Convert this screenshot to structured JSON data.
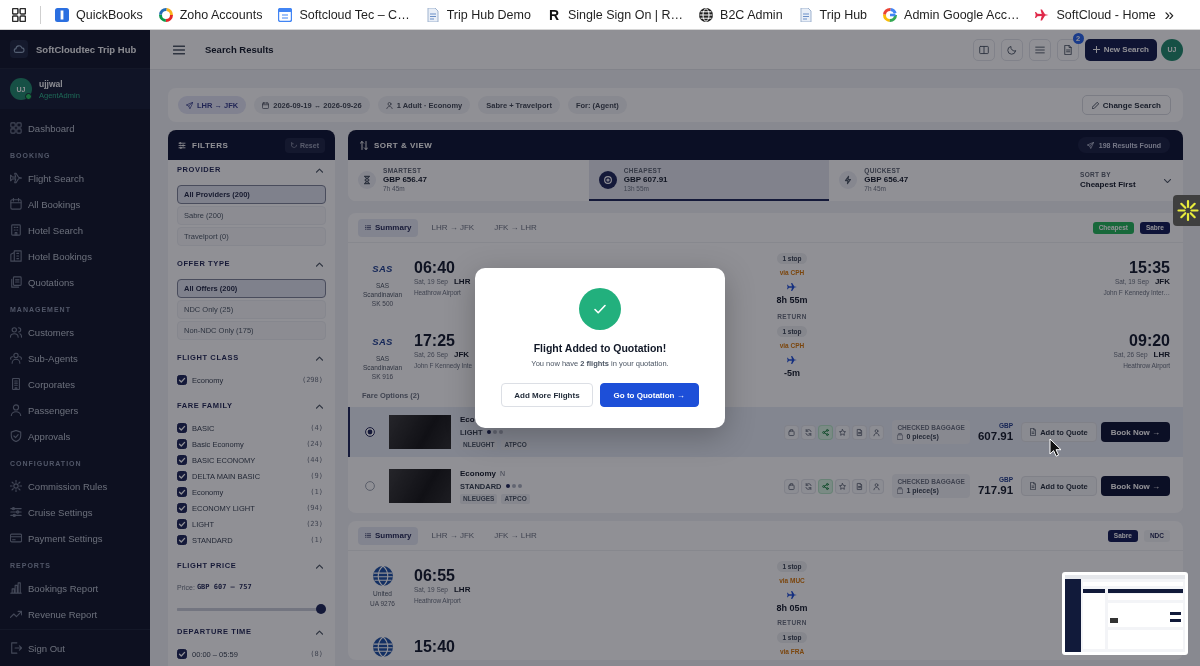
{
  "bookmarks": {
    "items": [
      {
        "label": "QuickBooks"
      },
      {
        "label": "Zoho Accounts"
      },
      {
        "label": "Softcloud Tec – C…"
      },
      {
        "label": "Trip Hub Demo"
      },
      {
        "label": "Single Sign On | R…",
        "icon_text": "R"
      },
      {
        "label": "B2C Admin"
      },
      {
        "label": "Trip Hub"
      },
      {
        "label": "Admin Google Acc…"
      },
      {
        "label": "SoftCloud - Home"
      }
    ],
    "more": "»"
  },
  "sidebar": {
    "brand": "SoftCloudtec Trip Hub",
    "user": {
      "initials": "UJ",
      "name": "ujjwal",
      "role": "AgentAdmin",
      "online": true
    },
    "nav": [
      {
        "items": [
          "Dashboard"
        ]
      },
      {
        "title": "BOOKING",
        "items": [
          "Flight Search",
          "All Bookings",
          "Hotel Search",
          "Hotel Bookings",
          "Quotations"
        ]
      },
      {
        "title": "MANAGEMENT",
        "items": [
          "Customers",
          "Sub-Agents",
          "Corporates",
          "Passengers",
          "Approvals"
        ]
      },
      {
        "title": "CONFIGURATION",
        "items": [
          "Commission Rules",
          "Cruise Settings",
          "Payment Settings"
        ]
      },
      {
        "title": "REPORTS",
        "items": [
          "Bookings Report",
          "Revenue Report"
        ]
      }
    ],
    "sign_out": "Sign Out"
  },
  "topbar": {
    "title": "Search Results",
    "notification_count": "2",
    "new_search": "New Search",
    "avatar": "UJ"
  },
  "search_summary": {
    "chips": [
      {
        "label": "LHR → JFK",
        "kind": "route"
      },
      {
        "label": "2026-09-19 ↔ 2026-09-26",
        "kind": "dates"
      },
      {
        "label": "1 Adult · Economy",
        "kind": "travellers"
      },
      {
        "label": "Sabre + Travelport",
        "kind": "plain"
      },
      {
        "label": "For: (Agent)",
        "kind": "plain"
      }
    ],
    "change_search": "Change Search"
  },
  "filters": {
    "title": "FILTERS",
    "reset": "Reset",
    "sections": [
      {
        "title": "PROVIDER",
        "kind": "options",
        "expanded": true,
        "options": [
          {
            "label": "All Providers (200)",
            "selected": true
          },
          {
            "label": "Sabre (200)",
            "selected": false
          },
          {
            "label": "Travelport (0)",
            "selected": false
          }
        ]
      },
      {
        "title": "OFFER TYPE",
        "kind": "options",
        "expanded": true,
        "options": [
          {
            "label": "All Offers (200)",
            "selected": true
          },
          {
            "label": "NDC Only (25)",
            "selected": false
          },
          {
            "label": "Non-NDC Only (175)",
            "selected": false
          }
        ]
      },
      {
        "title": "FLIGHT CLASS",
        "kind": "checks",
        "expanded": true,
        "items": [
          {
            "label": "Economy",
            "count": "(298)",
            "checked": true
          }
        ]
      },
      {
        "title": "FARE FAMILY",
        "kind": "checks",
        "expanded": true,
        "items": [
          {
            "label": "BASIC",
            "count": "(4)",
            "checked": true
          },
          {
            "label": "Basic Economy",
            "count": "(24)",
            "checked": true
          },
          {
            "label": "BASIC ECONOMY",
            "count": "(44)",
            "checked": true
          },
          {
            "label": "DELTA MAIN BASIC",
            "count": "(9)",
            "checked": true
          },
          {
            "label": "Economy",
            "count": "(1)",
            "checked": true
          },
          {
            "label": "ECONOMY LIGHT",
            "count": "(94)",
            "checked": true
          },
          {
            "label": "LIGHT",
            "count": "(23)",
            "checked": true
          },
          {
            "label": "STANDARD",
            "count": "(1)",
            "checked": true
          }
        ]
      },
      {
        "title": "FLIGHT PRICE",
        "kind": "range",
        "expanded": true,
        "label": "Price:",
        "value": "GBP 607 — 757",
        "level": 1
      },
      {
        "title": "DEPARTURE TIME",
        "kind": "checks",
        "expanded": true,
        "items": [
          {
            "label": "00:00 – 05:59",
            "count": "(8)",
            "checked": true
          }
        ]
      }
    ]
  },
  "sort": {
    "title": "SORT & VIEW",
    "results_found": "198 Results Found",
    "options": [
      {
        "label": "SMARTEST",
        "price": "GBP 656.47",
        "duration": "7h 45m",
        "selected": false
      },
      {
        "label": "CHEAPEST",
        "price": "GBP 607.91",
        "duration": "13h 55m",
        "selected": true
      },
      {
        "label": "QUICKEST",
        "price": "GBP 656.47",
        "duration": "7h 45m",
        "selected": false
      }
    ],
    "sort_by_label": "SORT BY",
    "sort_by": "Cheapest First"
  },
  "results": [
    {
      "tabs": [
        {
          "label": "Summary",
          "selected": true
        },
        {
          "label": "LHR → JFK",
          "selected": false
        },
        {
          "label": "JFK → LHR",
          "selected": false
        }
      ],
      "badges": [
        {
          "label": "Cheapest",
          "kind": "solid",
          "color": "#17693a"
        },
        {
          "label": "Sabre",
          "kind": "solid",
          "color": "#0e1438"
        }
      ],
      "legs": [
        {
          "logo": {
            "kind": "text",
            "text": "SAS"
          },
          "airline": "SAS Scandinavian",
          "flight": "SK 500",
          "depart": {
            "time": "06:40",
            "date": "Sat, 19 Sep",
            "code": "LHR",
            "airport": "Heathrow Airport"
          },
          "stops": "1 stop",
          "via": "via CPH",
          "duration": "8h 55m",
          "arrive": {
            "time": "15:35",
            "date": "Sat, 19 Sep",
            "code": "JFK",
            "airport": "John F Kennedy Inter…"
          }
        },
        {
          "logo": {
            "kind": "text",
            "text": "SAS"
          },
          "airline": "SAS Scandinavian",
          "flight": "SK 916",
          "depart": {
            "time": "17:25",
            "date": "Sat, 26 Sep",
            "code": "JFK",
            "airport": "John F Kennedy Inte"
          },
          "stops": "1 stop",
          "via": "via CPH",
          "duration": "-5m",
          "arrive": {
            "time": "09:20",
            "date": "Sat, 26 Sep",
            "code": "LHR",
            "airport": "Heathrow Airport"
          }
        }
      ],
      "return_label": "RETURN",
      "fares_title": "Fare Options (2)",
      "fares": [
        {
          "selected": true,
          "name": "Eco",
          "brand": "LIGHT",
          "stars": 1,
          "codes": [
            "NLEUGHT",
            "ATPCO"
          ],
          "features": [
            {
              "included": false
            },
            {
              "included": false
            },
            {
              "included": true
            },
            {
              "included": false
            },
            {
              "included": false
            },
            {
              "included": false
            }
          ],
          "baggage_label": "CHECKED BAGGAGE",
          "baggage": "0 piece(s)",
          "currency": "GBP",
          "price": "607.91",
          "quote": "Add to Quote",
          "book": "Book Now →"
        },
        {
          "selected": false,
          "name": "Economy",
          "class": "N",
          "brand": "STANDARD",
          "stars": 1,
          "codes": [
            "NLEUGES",
            "ATPCO"
          ],
          "features": [
            {
              "included": false
            },
            {
              "included": false
            },
            {
              "included": true
            },
            {
              "included": false
            },
            {
              "included": false
            },
            {
              "included": false
            }
          ],
          "baggage_label": "CHECKED BAGGAGE",
          "baggage": "1 piece(s)",
          "currency": "GBP",
          "price": "717.91",
          "quote": "Add to Quote",
          "book": "Book Now →"
        }
      ]
    },
    {
      "tabs": [
        {
          "label": "Summary",
          "selected": true
        },
        {
          "label": "LHR → JFK",
          "selected": false
        },
        {
          "label": "JFK → LHR",
          "selected": false
        }
      ],
      "badges": [
        {
          "label": "Sabre",
          "kind": "solid",
          "color": "#0e1438"
        },
        {
          "label": "NDC",
          "kind": "plain"
        }
      ],
      "legs": [
        {
          "logo": {
            "kind": "globe"
          },
          "airline": "United",
          "flight": "UA 9276",
          "depart": {
            "time": "06:55",
            "date": "Sat, 19 Sep",
            "code": "LHR",
            "airport": "Heathrow Airport"
          },
          "stops": "1 stop",
          "via": "via MUC",
          "duration": "8h 05m"
        },
        {
          "logo": {
            "kind": "globe"
          },
          "depart": {
            "time": "15:40"
          },
          "stops": "1 stop",
          "via": "via FRA"
        }
      ],
      "return_label": "RETURN"
    }
  ],
  "modal": {
    "title": "Flight Added to Quotation!",
    "message": "You now have **2 flights** in your quotation.",
    "buttons": [
      {
        "label": "Add More Flights",
        "kind": "secondary"
      },
      {
        "label": "Go to Quotation →",
        "kind": "primary"
      }
    ]
  }
}
